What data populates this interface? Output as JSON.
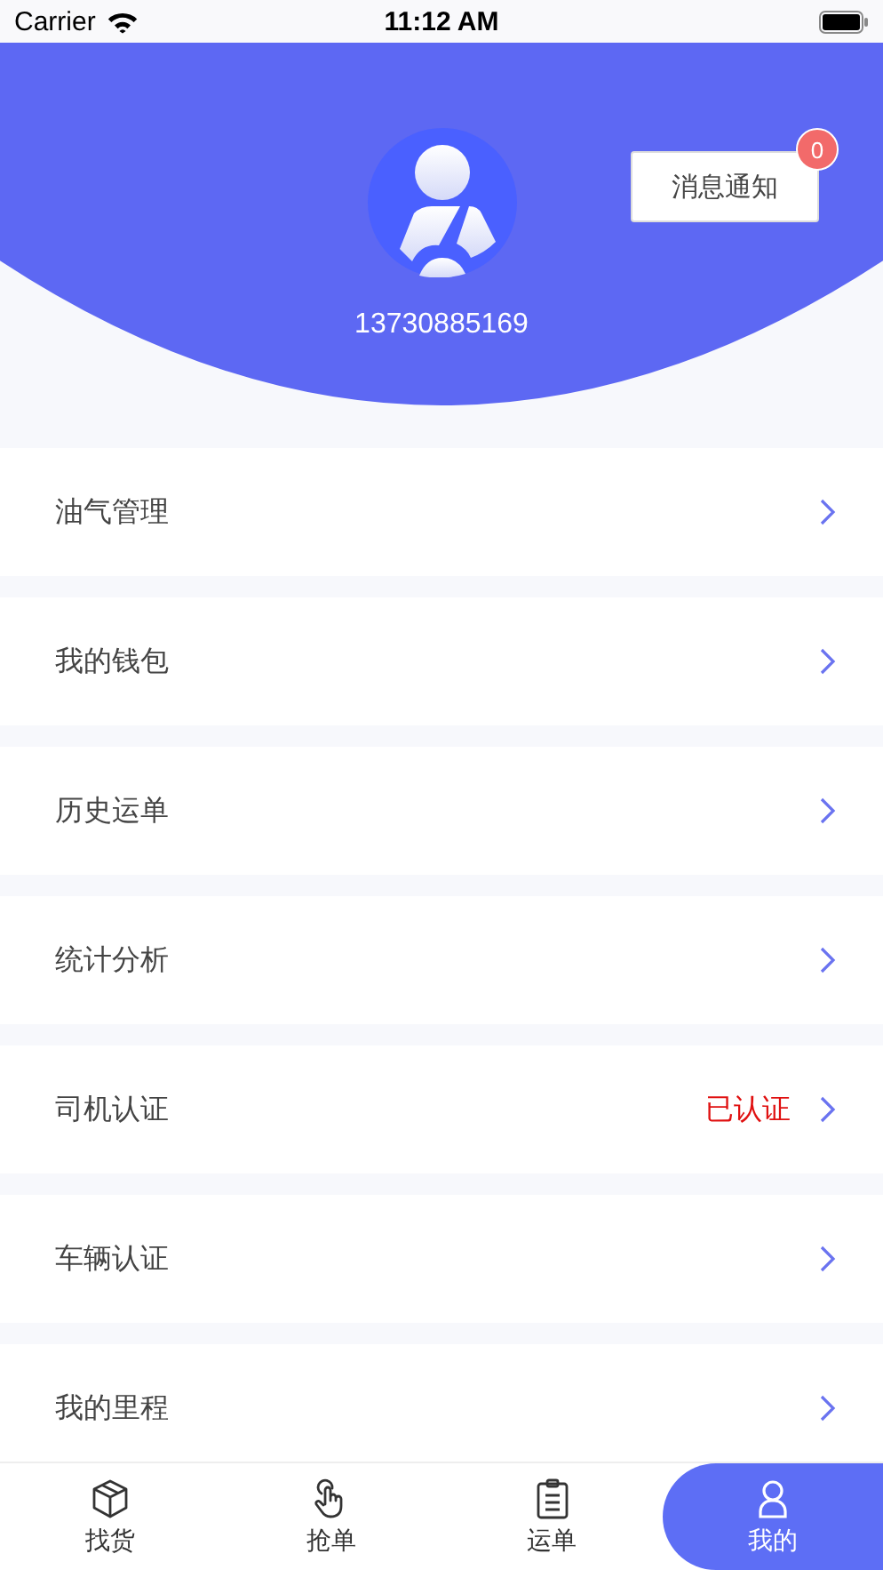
{
  "status_bar": {
    "carrier": "Carrier",
    "time": "11:12 AM"
  },
  "profile": {
    "phone": "13730885169",
    "notice_button": {
      "label": "消息通知",
      "badge": "0"
    }
  },
  "menu": [
    {
      "label": "油气管理"
    },
    {
      "label": "我的钱包"
    },
    {
      "label": "历史运单"
    },
    {
      "label": "统计分析"
    },
    {
      "label": "司机认证",
      "status": "已认证"
    },
    {
      "label": "车辆认证"
    },
    {
      "label": "我的里程"
    }
  ],
  "tabs": [
    {
      "label": "找货",
      "kind": "box",
      "selected": false
    },
    {
      "label": "抢单",
      "kind": "hand",
      "selected": false
    },
    {
      "label": "运单",
      "kind": "clipboard",
      "selected": false
    },
    {
      "label": "我的",
      "kind": "user",
      "selected": true
    }
  ]
}
